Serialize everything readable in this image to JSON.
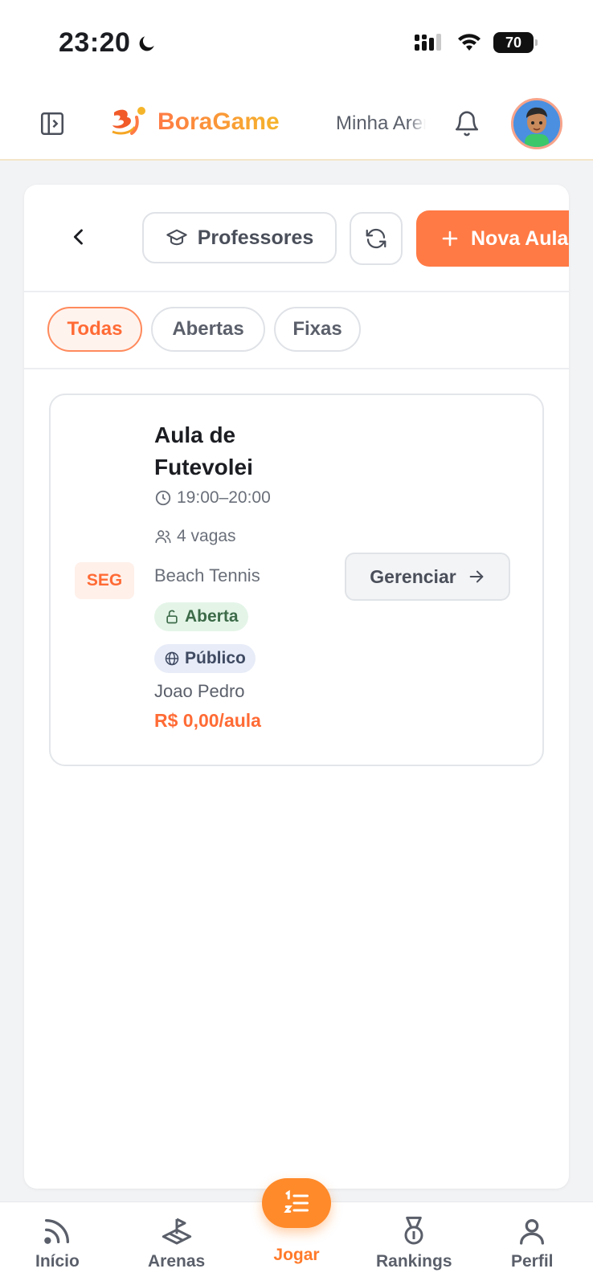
{
  "status_bar": {
    "time": "23:20",
    "battery": "70"
  },
  "header": {
    "app_name": "BoraGame",
    "arena_name": "Minha Arena"
  },
  "toolbar": {
    "professores_label": "Professores",
    "nova_aula_label": "Nova Aula"
  },
  "filters": [
    {
      "label": "Todas",
      "active": true
    },
    {
      "label": "Abertas",
      "active": false
    },
    {
      "label": "Fixas",
      "active": false
    }
  ],
  "class_card": {
    "day": "SEG",
    "title": "Aula de Futevolei",
    "time_range": "19:00–20:00",
    "spots": "4 vagas",
    "sport": "Beach Tennis",
    "status": "Aberta",
    "visibility": "Público",
    "teacher": "Joao Pedro",
    "price": "R$ 0,00/aula",
    "manage_label": "Gerenciar"
  },
  "bottom_nav": {
    "inicio": "Início",
    "arenas": "Arenas",
    "jogar": "Jogar",
    "rankings": "Rankings",
    "perfil": "Perfil"
  },
  "colors": {
    "accent": "#ff7a45",
    "success_bg": "#e4f5e8",
    "public_bg": "#e7ecf8"
  }
}
